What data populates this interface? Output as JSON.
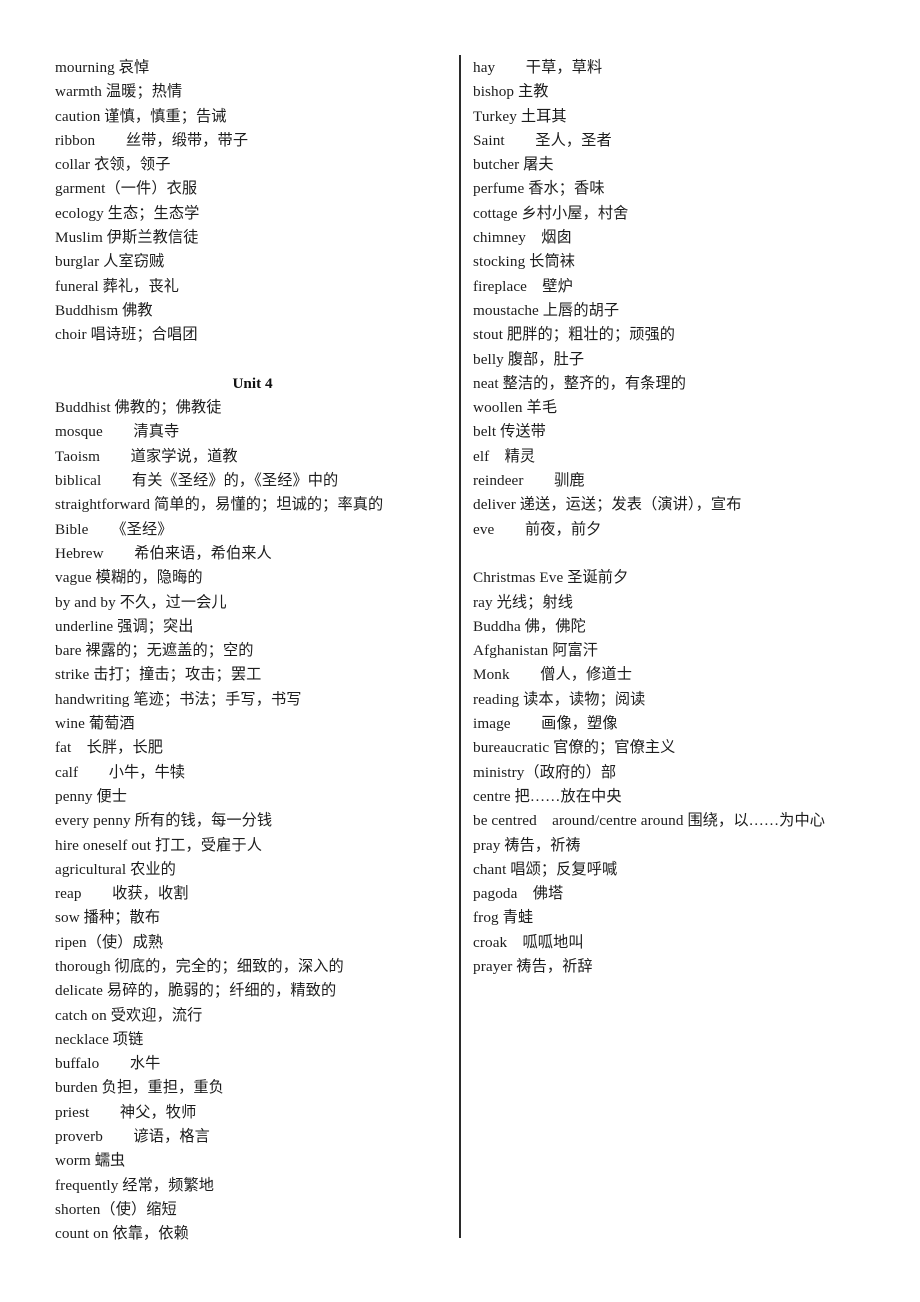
{
  "document": {
    "type": "vocabulary-glossary",
    "language_pair": "English-Chinese",
    "columns": 2
  },
  "left_column": {
    "entries": [
      {
        "kind": "entry",
        "text": "mourning 哀悼"
      },
      {
        "kind": "entry",
        "text": "warmth 温暖；热情"
      },
      {
        "kind": "entry",
        "text": "caution 谨慎，慎重；告诫"
      },
      {
        "kind": "entry",
        "text": "ribbon　　丝带，缎带，带子"
      },
      {
        "kind": "entry",
        "text": "collar 衣领，领子"
      },
      {
        "kind": "entry",
        "text": "garment（一件）衣服"
      },
      {
        "kind": "entry",
        "text": "ecology 生态；生态学"
      },
      {
        "kind": "entry",
        "text": "Muslim 伊斯兰教信徒"
      },
      {
        "kind": "entry",
        "text": "burglar 人室窃贼"
      },
      {
        "kind": "entry",
        "text": "funeral 葬礼，丧礼"
      },
      {
        "kind": "entry",
        "text": "Buddhism 佛教"
      },
      {
        "kind": "entry",
        "text": "choir 唱诗班；合唱团"
      },
      {
        "kind": "blank",
        "text": ""
      },
      {
        "kind": "heading",
        "text": "Unit 4"
      },
      {
        "kind": "entry",
        "text": "Buddhist 佛教的；佛教徒"
      },
      {
        "kind": "entry",
        "text": "mosque　　清真寺"
      },
      {
        "kind": "entry",
        "text": "Taoism　　道家学说，道教"
      },
      {
        "kind": "entry",
        "text": "biblical　　有关《圣经》的，《圣经》中的"
      },
      {
        "kind": "entry",
        "text": "straightforward 简单的，易懂的；坦诚的；率真的"
      },
      {
        "kind": "entry",
        "text": "Bible　　《圣经》"
      },
      {
        "kind": "entry",
        "text": "Hebrew　　希伯来语，希伯来人"
      },
      {
        "kind": "entry",
        "text": "vague 模糊的，隐晦的"
      },
      {
        "kind": "entry",
        "text": "by and by 不久，过一会儿"
      },
      {
        "kind": "entry",
        "text": "underline 强调；突出"
      },
      {
        "kind": "entry",
        "text": "bare 裸露的；无遮盖的；空的"
      },
      {
        "kind": "entry",
        "text": "strike 击打；撞击；攻击；罢工"
      },
      {
        "kind": "entry",
        "text": "handwriting 笔迹；书法；手写，书写"
      },
      {
        "kind": "entry",
        "text": "wine 葡萄酒"
      },
      {
        "kind": "entry",
        "text": "fat　长胖，长肥"
      },
      {
        "kind": "entry",
        "text": "calf　　小牛，牛犊"
      },
      {
        "kind": "entry",
        "text": "penny 便士"
      },
      {
        "kind": "entry",
        "text": "every penny 所有的钱，每一分钱"
      },
      {
        "kind": "entry",
        "text": "hire oneself out 打工，受雇于人"
      },
      {
        "kind": "entry",
        "text": "agricultural 农业的"
      },
      {
        "kind": "entry",
        "text": "reap　　收获，收割"
      },
      {
        "kind": "entry",
        "text": "sow 播种；散布"
      },
      {
        "kind": "entry",
        "text": "ripen（使）成熟"
      },
      {
        "kind": "entry",
        "text": "thorough 彻底的，完全的；细致的，深入的"
      },
      {
        "kind": "entry",
        "text": "delicate 易碎的，脆弱的；纤细的，精致的"
      },
      {
        "kind": "entry",
        "text": "catch on 受欢迎，流行"
      },
      {
        "kind": "entry",
        "text": "necklace 项链"
      },
      {
        "kind": "entry",
        "text": "buffalo　　水牛"
      },
      {
        "kind": "entry",
        "text": "burden 负担，重担，重负"
      },
      {
        "kind": "entry",
        "text": "priest　　神父，牧师"
      },
      {
        "kind": "entry",
        "text": "proverb　　谚语，格言"
      },
      {
        "kind": "entry",
        "text": "worm 蠕虫"
      },
      {
        "kind": "entry",
        "text": "frequently 经常，频繁地"
      },
      {
        "kind": "entry",
        "text": "shorten（使）缩短"
      },
      {
        "kind": "entry",
        "text": "count on 依靠，依赖"
      }
    ]
  },
  "right_column": {
    "entries": [
      {
        "kind": "entry",
        "text": "hay　　干草，草料"
      },
      {
        "kind": "entry",
        "text": "bishop 主教"
      },
      {
        "kind": "entry",
        "text": "Turkey 土耳其"
      },
      {
        "kind": "entry",
        "text": "Saint　　圣人，圣者"
      },
      {
        "kind": "entry",
        "text": "butcher 屠夫"
      },
      {
        "kind": "entry",
        "text": "perfume 香水；香味"
      },
      {
        "kind": "entry",
        "text": "cottage 乡村小屋，村舍"
      },
      {
        "kind": "entry",
        "text": "chimney　烟囱"
      },
      {
        "kind": "entry",
        "text": "stocking 长筒袜"
      },
      {
        "kind": "entry",
        "text": "fireplace　壁炉"
      },
      {
        "kind": "entry",
        "text": "moustache 上唇的胡子"
      },
      {
        "kind": "entry",
        "text": "stout 肥胖的；粗壮的；顽强的"
      },
      {
        "kind": "entry",
        "text": "belly 腹部，肚子"
      },
      {
        "kind": "entry",
        "text": "neat 整洁的，整齐的，有条理的"
      },
      {
        "kind": "entry",
        "text": "woollen 羊毛"
      },
      {
        "kind": "entry",
        "text": "belt 传送带"
      },
      {
        "kind": "entry",
        "text": "elf　精灵"
      },
      {
        "kind": "entry",
        "text": "reindeer　　驯鹿"
      },
      {
        "kind": "entry",
        "text": "deliver 递送，运送；发表（演讲），宣布"
      },
      {
        "kind": "entry",
        "text": "eve　　前夜，前夕"
      },
      {
        "kind": "blank",
        "text": ""
      },
      {
        "kind": "entry",
        "text": "Christmas Eve 圣诞前夕"
      },
      {
        "kind": "entry",
        "text": "ray 光线；射线"
      },
      {
        "kind": "entry",
        "text": "Buddha 佛，佛陀"
      },
      {
        "kind": "entry",
        "text": "Afghanistan 阿富汗"
      },
      {
        "kind": "entry",
        "text": "Monk　　僧人，修道士"
      },
      {
        "kind": "entry",
        "text": "reading 读本，读物；阅读"
      },
      {
        "kind": "entry",
        "text": "image　　画像，塑像"
      },
      {
        "kind": "entry",
        "text": "bureaucratic 官僚的；官僚主义"
      },
      {
        "kind": "entry",
        "text": "ministry（政府的）部"
      },
      {
        "kind": "entry",
        "text": "centre 把……放在中央"
      },
      {
        "kind": "entry",
        "text": "be centred　around/centre around 围绕，以……为中心"
      },
      {
        "kind": "entry",
        "text": "pray 祷告，祈祷"
      },
      {
        "kind": "entry",
        "text": "chant 唱颂；反复呼喊"
      },
      {
        "kind": "entry",
        "text": "pagoda　佛塔"
      },
      {
        "kind": "entry",
        "text": "frog 青蛙"
      },
      {
        "kind": "entry",
        "text": "croak　呱呱地叫"
      },
      {
        "kind": "entry",
        "text": "prayer 祷告，祈辞"
      }
    ]
  },
  "style": {
    "text_color": "#1c1c1c",
    "background_color": "#ffffff",
    "divider_color": "#2b2b2b"
  }
}
